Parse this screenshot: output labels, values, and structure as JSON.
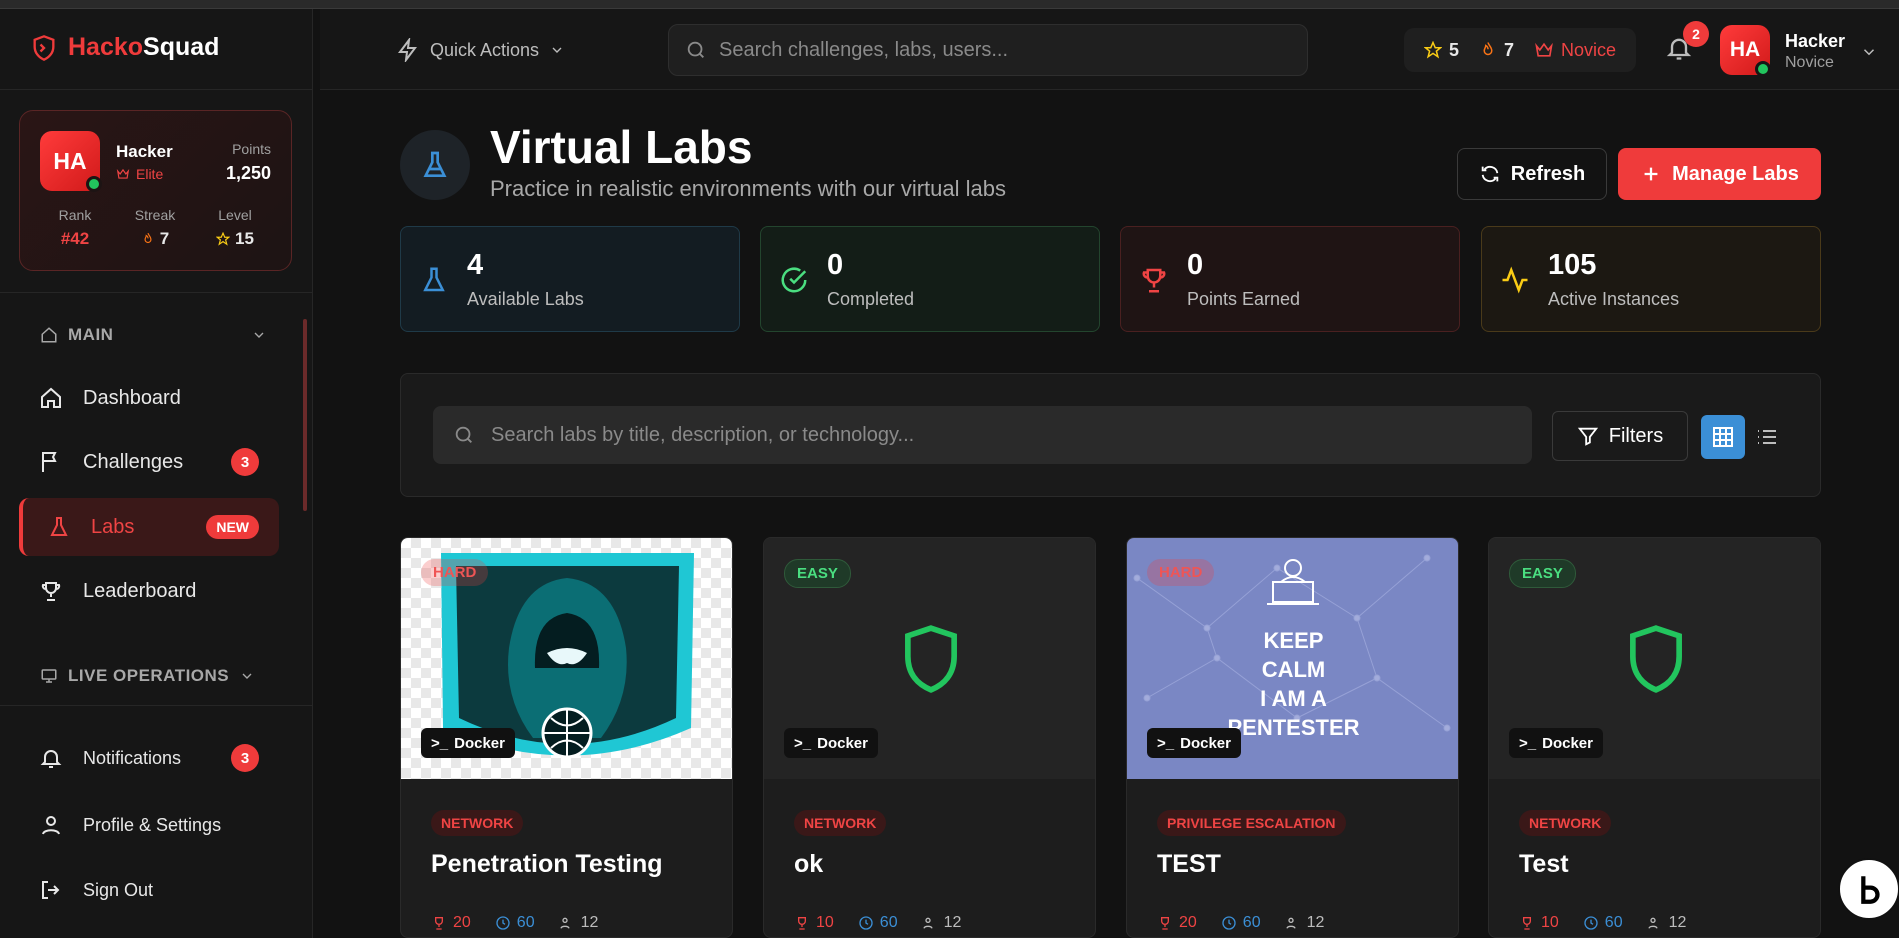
{
  "app": {
    "brand_a": "Hacko",
    "brand_b": "Squad"
  },
  "profile": {
    "initials": "HA",
    "name": "Hacker",
    "role": "Elite",
    "points_label": "Points",
    "points": "1,250",
    "rank_label": "Rank",
    "rank": "#42",
    "streak_label": "Streak",
    "streak": "7",
    "level_label": "Level",
    "level": "15"
  },
  "sidebar": {
    "main_section": "MAIN",
    "items": [
      {
        "label": "Dashboard"
      },
      {
        "label": "Challenges",
        "badge": "3"
      },
      {
        "label": "Labs",
        "badge": "NEW"
      },
      {
        "label": "Leaderboard"
      }
    ],
    "live_section": "LIVE OPERATIONS",
    "bottom": [
      {
        "label": "Notifications",
        "badge": "3"
      },
      {
        "label": "Profile & Settings"
      },
      {
        "label": "Sign Out"
      }
    ]
  },
  "header": {
    "quick_actions": "Quick Actions",
    "search_placeholder": "Search challenges, labs, users...",
    "stars": "5",
    "streak": "7",
    "tier": "Novice",
    "notif_count": "2",
    "user_initials": "HA",
    "user_name": "Hacker",
    "user_role": "Novice"
  },
  "page": {
    "title": "Virtual Labs",
    "subtitle": "Practice in realistic environments with our virtual labs",
    "refresh": "Refresh",
    "manage": "Manage Labs"
  },
  "stats": [
    {
      "value": "4",
      "label": "Available Labs"
    },
    {
      "value": "0",
      "label": "Completed"
    },
    {
      "value": "0",
      "label": "Points Earned"
    },
    {
      "value": "105",
      "label": "Active Instances"
    }
  ],
  "filters": {
    "search_placeholder": "Search labs by title, description, or technology...",
    "filters_label": "Filters"
  },
  "labs": [
    {
      "difficulty": "HARD",
      "platform": "Docker",
      "category": "NETWORK",
      "title": "Penetration Testing",
      "points": "20",
      "minutes": "60",
      "users": "12"
    },
    {
      "difficulty": "EASY",
      "platform": "Docker",
      "category": "NETWORK",
      "title": "ok",
      "points": "10",
      "minutes": "60",
      "users": "12"
    },
    {
      "difficulty": "HARD",
      "platform": "Docker",
      "category": "PRIVILEGE ESCALATION",
      "title": "TEST",
      "points": "20",
      "minutes": "60",
      "users": "12",
      "image_text": [
        "KEEP",
        "CALM",
        "I AM A",
        "PENTESTER"
      ]
    },
    {
      "difficulty": "EASY",
      "platform": "Docker",
      "category": "NETWORK",
      "title": "Test",
      "points": "10",
      "minutes": "60",
      "users": "12"
    }
  ],
  "colors": {
    "accent": "#ef3b3b",
    "easy": "#4ade80",
    "blue": "#3b8fd6"
  }
}
